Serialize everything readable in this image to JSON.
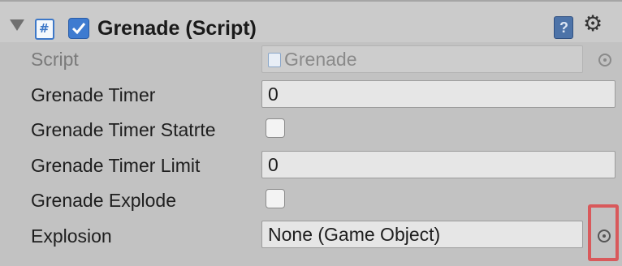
{
  "component": {
    "title": "Grenade (Script)",
    "icon": "csharp-script-icon",
    "enabled": true
  },
  "fields": {
    "script": {
      "label": "Script",
      "value": "Grenade"
    },
    "grenade_timer": {
      "label": "Grenade Timer",
      "value": "0"
    },
    "grenade_timer_started": {
      "label": "Grenade Timer Statrte",
      "checked": false
    },
    "grenade_timer_limit": {
      "label": "Grenade Timer Limit",
      "value": "0"
    },
    "grenade_explode": {
      "label": "Grenade Explode",
      "checked": false
    },
    "explosion": {
      "label": "Explosion",
      "value": "None (Game Object)"
    }
  },
  "colors": {
    "accent": "#3e7bd0",
    "highlight_box": "#d9595b"
  }
}
